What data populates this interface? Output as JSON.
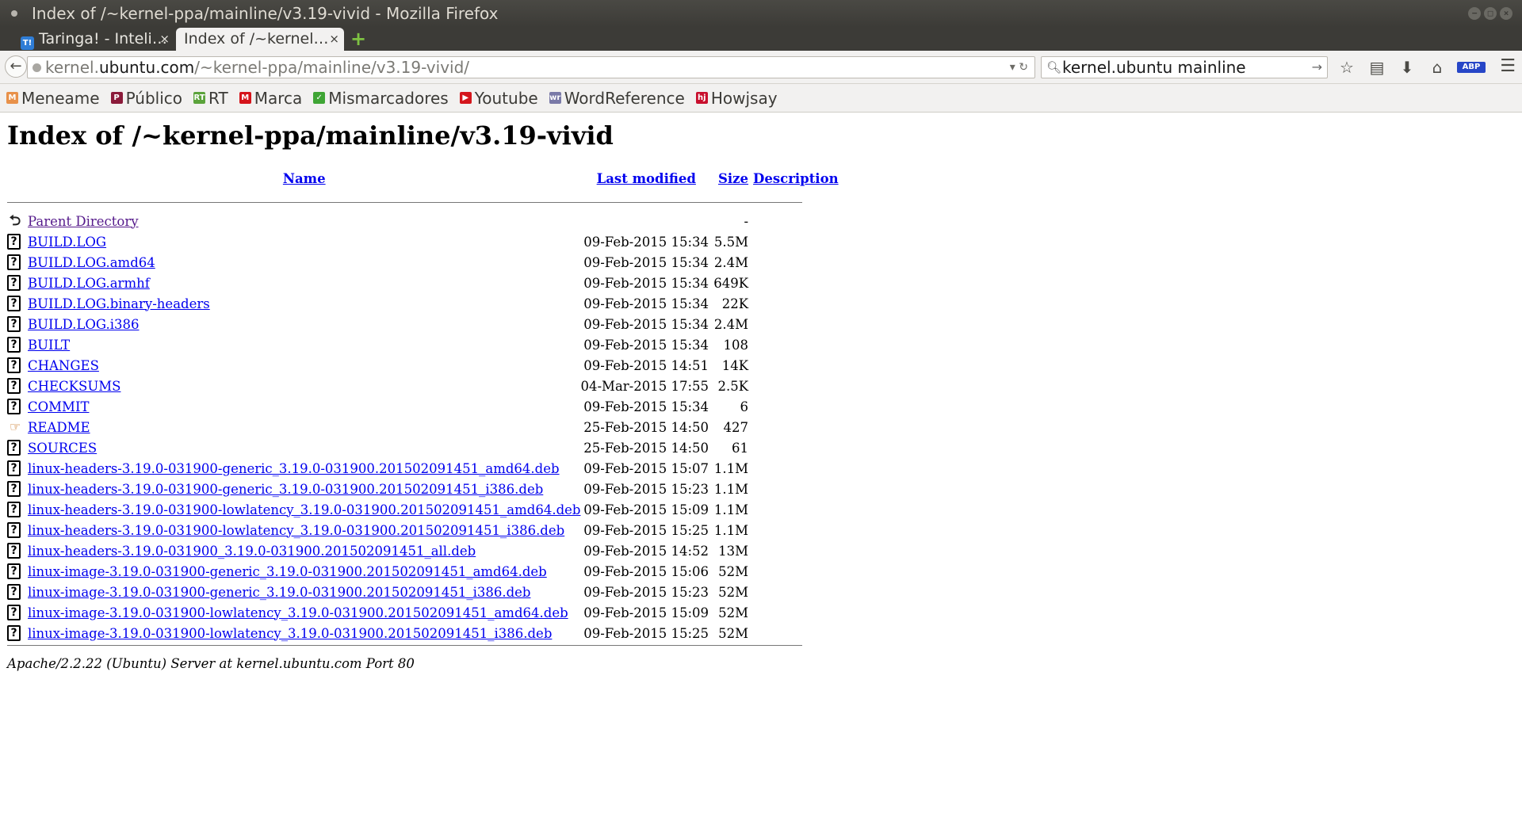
{
  "window": {
    "title": "Index of /~kernel-ppa/mainline/v3.19-vivid - Mozilla Firefox",
    "controls": [
      "−",
      "□",
      "×"
    ]
  },
  "tabs": [
    {
      "favicon": "T!",
      "label": "Taringa! - Inteli…",
      "close": "×"
    },
    {
      "label": "Index of /~kernel…",
      "close": "×"
    }
  ],
  "newtab_label": "+",
  "nav": {
    "back": "←",
    "url_domain_prefix": "kernel.",
    "url_domain": "ubuntu.com",
    "url_path": "/~kernel-ppa/mainline/v3.19-vivid/",
    "url_actions": "▾ ↻",
    "search_value": "kernel.ubuntu mainline",
    "search_go": "→",
    "icons": [
      "star-icon",
      "reading-list-icon",
      "download-icon",
      "home-icon",
      "adblock-icon",
      "menu-icon"
    ],
    "abp": "ABP"
  },
  "bookmarks": [
    {
      "label": "Meneame",
      "icon": "M",
      "color": "#e8914a"
    },
    {
      "label": "Público",
      "icon": "P",
      "color": "#8b1b3a"
    },
    {
      "label": "RT",
      "icon": "RT",
      "color": "#5ba33b"
    },
    {
      "label": "Marca",
      "icon": "M",
      "color": "#d5141b"
    },
    {
      "label": "Mismarcadores",
      "icon": "✓",
      "color": "#3fa535"
    },
    {
      "label": "Youtube",
      "icon": "▶",
      "color": "#d4161c"
    },
    {
      "label": "WordReference",
      "icon": "wr",
      "color": "#7a7aa8"
    },
    {
      "label": "Howjsay",
      "icon": "hj",
      "color": "#c8102e"
    }
  ],
  "page": {
    "heading": "Index of /~kernel-ppa/mainline/v3.19-vivid",
    "columns": {
      "name": "Name",
      "modified": "Last modified",
      "size": "Size",
      "description": "Description"
    },
    "parent": {
      "name": "Parent Directory",
      "size": "-"
    },
    "files": [
      {
        "name": "BUILD.LOG",
        "modified": "09-Feb-2015 15:34",
        "size": "5.5M",
        "icon": "unknown"
      },
      {
        "name": "BUILD.LOG.amd64",
        "modified": "09-Feb-2015 15:34",
        "size": "2.4M",
        "icon": "unknown"
      },
      {
        "name": "BUILD.LOG.armhf",
        "modified": "09-Feb-2015 15:34",
        "size": "649K",
        "icon": "unknown"
      },
      {
        "name": "BUILD.LOG.binary-headers",
        "modified": "09-Feb-2015 15:34",
        "size": "22K",
        "icon": "unknown"
      },
      {
        "name": "BUILD.LOG.i386",
        "modified": "09-Feb-2015 15:34",
        "size": "2.4M",
        "icon": "unknown"
      },
      {
        "name": "BUILT",
        "modified": "09-Feb-2015 15:34",
        "size": "108",
        "icon": "unknown"
      },
      {
        "name": "CHANGES",
        "modified": "09-Feb-2015 14:51",
        "size": "14K",
        "icon": "unknown"
      },
      {
        "name": "CHECKSUMS",
        "modified": "04-Mar-2015 17:55",
        "size": "2.5K",
        "icon": "unknown"
      },
      {
        "name": "COMMIT",
        "modified": "09-Feb-2015 15:34",
        "size": "6",
        "icon": "unknown"
      },
      {
        "name": "README",
        "modified": "25-Feb-2015 14:50",
        "size": "427",
        "icon": "readme"
      },
      {
        "name": "SOURCES",
        "modified": "25-Feb-2015 14:50",
        "size": "61",
        "icon": "unknown"
      },
      {
        "name": "linux-headers-3.19.0-031900-generic_3.19.0-031900.201502091451_amd64.deb",
        "modified": "09-Feb-2015 15:07",
        "size": "1.1M",
        "icon": "unknown"
      },
      {
        "name": "linux-headers-3.19.0-031900-generic_3.19.0-031900.201502091451_i386.deb",
        "modified": "09-Feb-2015 15:23",
        "size": "1.1M",
        "icon": "unknown"
      },
      {
        "name": "linux-headers-3.19.0-031900-lowlatency_3.19.0-031900.201502091451_amd64.deb",
        "modified": "09-Feb-2015 15:09",
        "size": "1.1M",
        "icon": "unknown"
      },
      {
        "name": "linux-headers-3.19.0-031900-lowlatency_3.19.0-031900.201502091451_i386.deb",
        "modified": "09-Feb-2015 15:25",
        "size": "1.1M",
        "icon": "unknown"
      },
      {
        "name": "linux-headers-3.19.0-031900_3.19.0-031900.201502091451_all.deb",
        "modified": "09-Feb-2015 14:52",
        "size": "13M",
        "icon": "unknown"
      },
      {
        "name": "linux-image-3.19.0-031900-generic_3.19.0-031900.201502091451_amd64.deb",
        "modified": "09-Feb-2015 15:06",
        "size": "52M",
        "icon": "unknown"
      },
      {
        "name": "linux-image-3.19.0-031900-generic_3.19.0-031900.201502091451_i386.deb",
        "modified": "09-Feb-2015 15:23",
        "size": "52M",
        "icon": "unknown"
      },
      {
        "name": "linux-image-3.19.0-031900-lowlatency_3.19.0-031900.201502091451_amd64.deb",
        "modified": "09-Feb-2015 15:09",
        "size": "52M",
        "icon": "unknown"
      },
      {
        "name": "linux-image-3.19.0-031900-lowlatency_3.19.0-031900.201502091451_i386.deb",
        "modified": "09-Feb-2015 15:25",
        "size": "52M",
        "icon": "unknown"
      }
    ],
    "footer": "Apache/2.2.22 (Ubuntu) Server at kernel.ubuntu.com Port 80"
  }
}
